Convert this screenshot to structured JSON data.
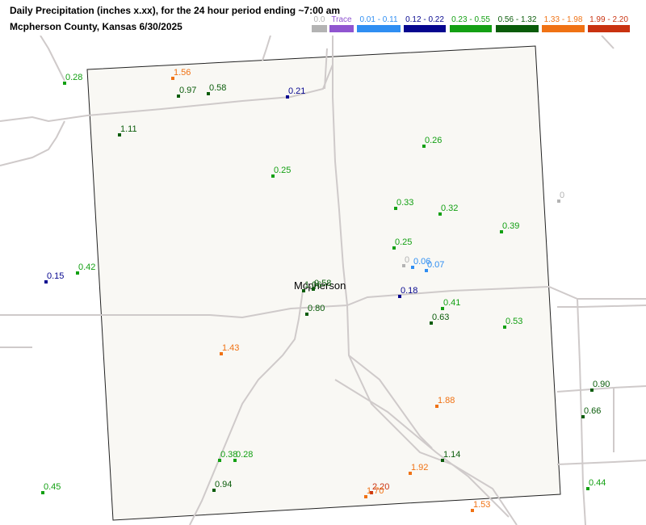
{
  "title_line1": "Daily Precipitation (inches  x.xx),  for the 24 hour period ending ~7:00 am",
  "title_line2": "Mcpherson County, Kansas  6/30/2025",
  "legend": [
    {
      "label": "0.0",
      "color": "#b3b3b3"
    },
    {
      "label": "Trace",
      "color": "#9055d0"
    },
    {
      "label": "0.01 - 0.11",
      "color": "#2f8ef2"
    },
    {
      "label": "0.12 - 0.22",
      "color": "#06068f"
    },
    {
      "label": "0.23 - 0.55",
      "color": "#13a013"
    },
    {
      "label": "0.56 - 1.32",
      "color": "#0a5c0a"
    },
    {
      "label": "1.33 - 1.98",
      "color": "#f07214"
    },
    {
      "label": "1.99 - 2.20",
      "color": "#c93210"
    }
  ],
  "city": "Mcpherson",
  "stations": [
    {
      "value": "0.28",
      "cls": 4
    },
    {
      "value": "1.56",
      "cls": 6
    },
    {
      "value": "0.97",
      "cls": 5
    },
    {
      "value": "0.58",
      "cls": 5
    },
    {
      "value": "0.21",
      "cls": 3
    },
    {
      "value": "1.11",
      "cls": 5
    },
    {
      "value": "0.25",
      "cls": 4
    },
    {
      "value": "0.26",
      "cls": 4
    },
    {
      "value": "0",
      "cls": 0
    },
    {
      "value": "0.33",
      "cls": 4
    },
    {
      "value": "0.32",
      "cls": 4
    },
    {
      "value": "0.39",
      "cls": 4
    },
    {
      "value": "0.25",
      "cls": 4
    },
    {
      "value": "0",
      "cls": 0
    },
    {
      "value": "0.06",
      "cls": 2
    },
    {
      "value": "0.07",
      "cls": 2
    },
    {
      "value": "0.15",
      "cls": 3
    },
    {
      "value": "0.42",
      "cls": 4
    },
    {
      "value": "1.06",
      "cls": 5
    },
    {
      "value": "0.58",
      "cls": 5
    },
    {
      "value": "0.18",
      "cls": 3
    },
    {
      "value": "0.41",
      "cls": 4
    },
    {
      "value": "0.80",
      "cls": 5
    },
    {
      "value": "0.63",
      "cls": 5
    },
    {
      "value": "0.53",
      "cls": 4
    },
    {
      "value": "1.43",
      "cls": 6
    },
    {
      "value": "0.90",
      "cls": 5
    },
    {
      "value": "1.88",
      "cls": 6
    },
    {
      "value": "0.66",
      "cls": 5
    },
    {
      "value": "1.14",
      "cls": 5
    },
    {
      "value": "0.38",
      "cls": 4
    },
    {
      "value": "0.28",
      "cls": 4
    },
    {
      "value": "1.92",
      "cls": 6
    },
    {
      "value": "0.94",
      "cls": 5
    },
    {
      "value": "2.20",
      "cls": 7
    },
    {
      "value": "1.70",
      "cls": 6
    },
    {
      "value": "0.45",
      "cls": 4
    },
    {
      "value": "0.44",
      "cls": 4
    },
    {
      "value": "1.53",
      "cls": 6
    }
  ]
}
